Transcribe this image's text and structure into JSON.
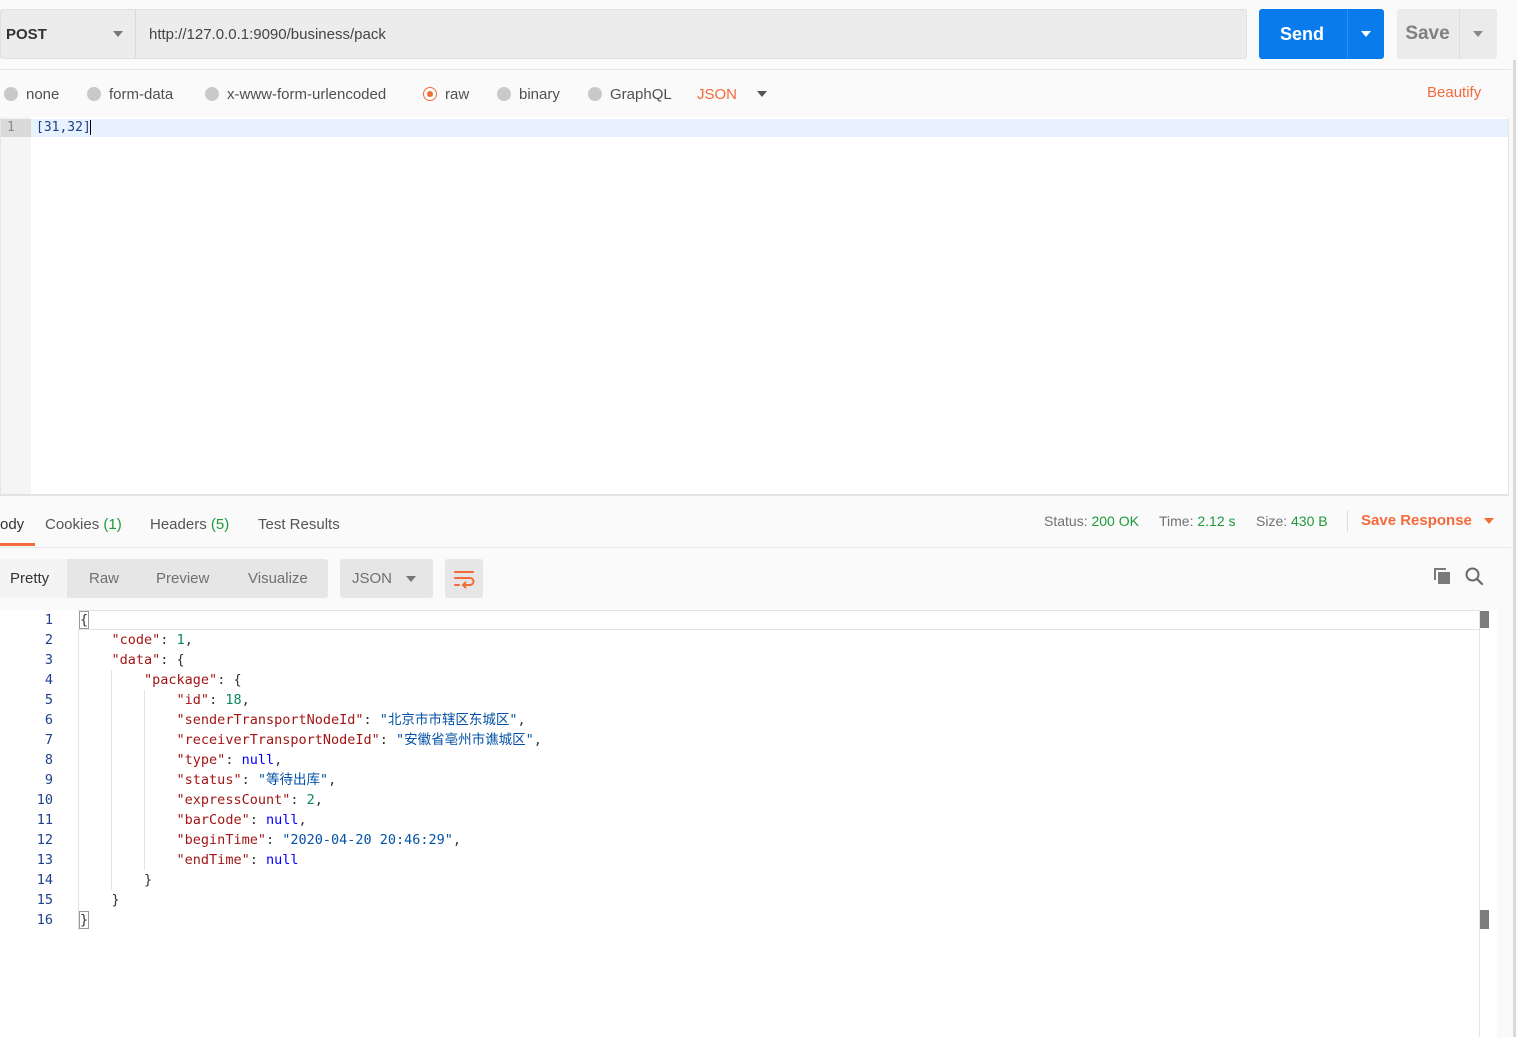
{
  "request": {
    "method": "POST",
    "url": "http://127.0.0.1:9090/business/pack",
    "send_label": "Send",
    "save_label": "Save"
  },
  "body_types": {
    "options": [
      "none",
      "form-data",
      "x-www-form-urlencoded",
      "raw",
      "binary",
      "GraphQL"
    ],
    "selected": "raw",
    "format": "JSON",
    "beautify_label": "Beautify"
  },
  "request_body": {
    "line_number": "1",
    "text": "[31,32]"
  },
  "response_tabs": {
    "body": "ody",
    "cookies": "Cookies",
    "cookies_count": "(1)",
    "headers": "Headers",
    "headers_count": "(5)",
    "test_results": "Test Results"
  },
  "response_meta": {
    "status_label": "Status:",
    "status_value": "200 OK",
    "time_label": "Time:",
    "time_value": "2.12 s",
    "size_label": "Size:",
    "size_value": "430 B",
    "save_response_label": "Save Response"
  },
  "view": {
    "modes": [
      "Pretty",
      "Raw",
      "Preview",
      "Visualize"
    ],
    "format": "JSON"
  },
  "response_body": {
    "line_numbers": [
      "1",
      "2",
      "3",
      "4",
      "5",
      "6",
      "7",
      "8",
      "9",
      "10",
      "11",
      "12",
      "13",
      "14",
      "15",
      "16"
    ],
    "open_brace": "{",
    "code_key": "\"code\"",
    "code_val": "1",
    "data_key": "\"data\"",
    "package_key": "\"package\"",
    "id_key": "\"id\"",
    "id_val": "18",
    "sender_key": "\"senderTransportNodeId\"",
    "sender_val": "\"北京市市辖区东城区\"",
    "receiver_key": "\"receiverTransportNodeId\"",
    "receiver_val": "\"安徽省亳州市谯城区\"",
    "type_key": "\"type\"",
    "type_val": "null",
    "status_key": "\"status\"",
    "status_val": "\"等待出库\"",
    "express_key": "\"expressCount\"",
    "express_val": "2",
    "barcode_key": "\"barCode\"",
    "barcode_val": "null",
    "begin_key": "\"beginTime\"",
    "begin_val": "\"2020-04-20 20:46:29\"",
    "end_key": "\"endTime\"",
    "end_val": "null",
    "close_brace": "}"
  },
  "colors": {
    "accent": "#f26b3a",
    "send": "#097bed",
    "success": "#1d9a3a"
  },
  "icons": [
    "caret-down-icon",
    "wrap-lines-icon",
    "copy-icon",
    "search-icon"
  ]
}
